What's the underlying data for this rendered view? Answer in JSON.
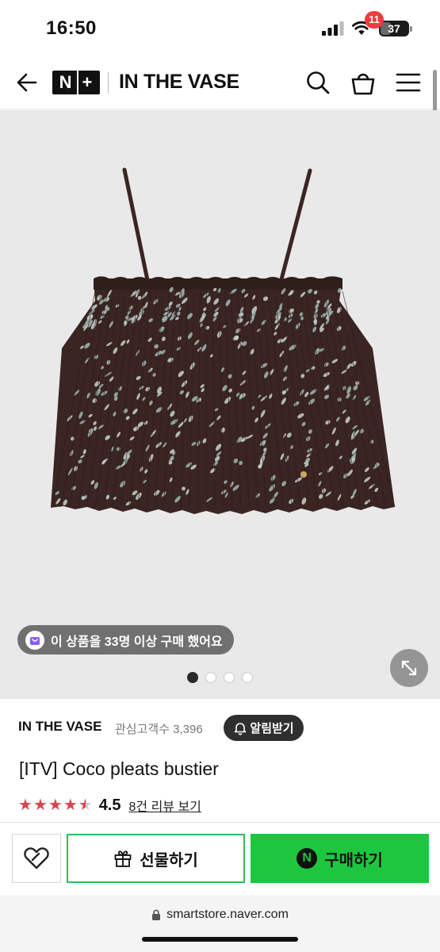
{
  "status_bar": {
    "time": "16:50",
    "battery": "37",
    "battery_level": 0.37
  },
  "header": {
    "logo_text": "N+",
    "store_name": "IN THE VASE",
    "cart_count": "11",
    "icons": [
      "back-arrow-icon",
      "search-icon",
      "cart-icon",
      "menu-icon"
    ]
  },
  "gallery": {
    "buyers_badge": "이 상품을 33명 이상 구매 했어요",
    "current_image": 1,
    "image_count": 4
  },
  "product": {
    "brand": "IN THE VASE",
    "fans": "관심고객수 3,396",
    "alarm_label": "알림받기",
    "title": "[ITV] Coco pleats bustier",
    "rating": "4.5",
    "rating_value": 4.5,
    "review_link": "8건 리뷰 보기"
  },
  "actions": {
    "gift_label": "선물하기",
    "buy_label": "구매하기",
    "buy_icon_text": "N"
  },
  "browser": {
    "url": "smartstore.naver.com"
  },
  "colors": {
    "accent_green": "#1ec640",
    "gift_border": "#2dbd5a",
    "badge_red": "#ef3b3b",
    "star_red": "#d9434f",
    "garment": "#3a2522"
  }
}
